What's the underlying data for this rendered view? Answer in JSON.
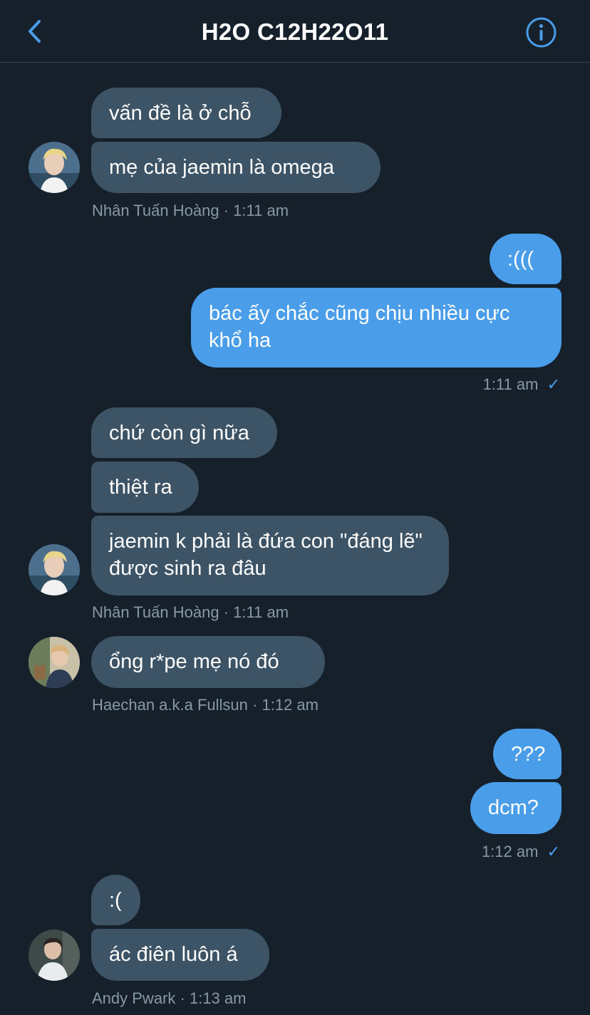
{
  "header": {
    "title": "H2O C12H22O11",
    "back_icon": "chevron-left-icon",
    "info_icon": "info-circle-icon",
    "accent": "#4a9de8"
  },
  "messages": {
    "g1": {
      "b1": "vấn đề là ở chỗ",
      "b2": "mẹ của jaemin là omega",
      "sender": "Nhân Tuấn Hoàng",
      "time": "1:11 am"
    },
    "g2": {
      "b1": ":(((",
      "b2": "bác ấy chắc cũng chịu nhiều cực khổ ha",
      "time": "1:11 am",
      "status": "✓"
    },
    "g3": {
      "b1": "chứ còn gì nữa",
      "b2": "thiệt ra",
      "b3": "jaemin k phải là đứa con \"đáng lẽ\" được sinh ra đâu",
      "sender": "Nhân Tuấn Hoàng",
      "time": "1:11 am"
    },
    "g4": {
      "b1": "ổng r*pe mẹ nó đó",
      "sender": "Haechan a.k.a Fullsun",
      "time": "1:12 am"
    },
    "g5": {
      "b1": "???",
      "b2": "dcm?",
      "time": "1:12 am",
      "status": "✓"
    },
    "g6": {
      "b1": ":(",
      "b2": "ác điên luôn á",
      "sender": "Andy Pwark",
      "time": "1:13 am"
    }
  },
  "colors": {
    "background": "#15202b",
    "incoming_bubble": "#3d5466",
    "outgoing_bubble": "#4a9de8",
    "meta_text": "#8899a6"
  }
}
